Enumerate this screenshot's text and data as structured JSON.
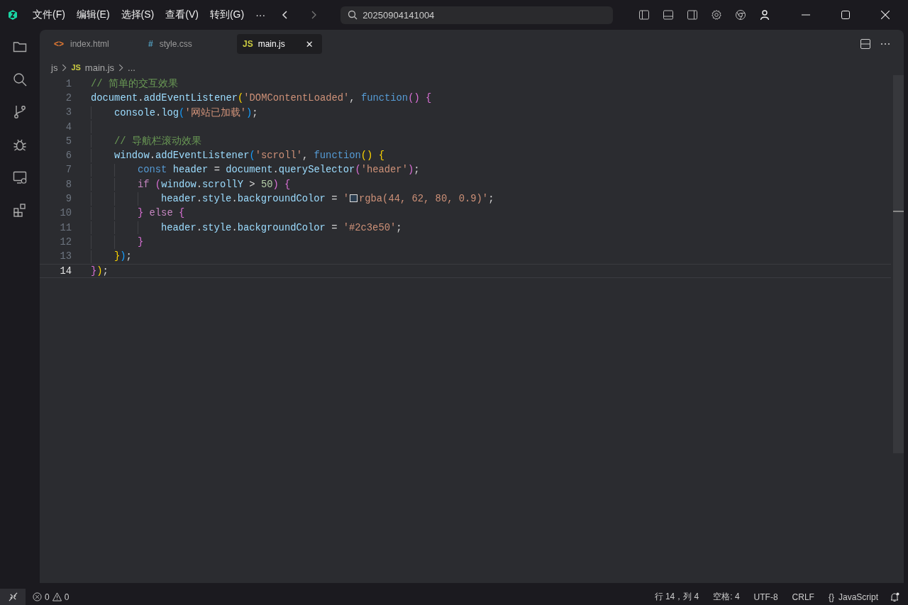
{
  "menu": [
    "文件(F)",
    "编辑(E)",
    "选择(S)",
    "查看(V)",
    "转到(G)",
    "···"
  ],
  "command_center": {
    "value": "20250904141004"
  },
  "activity_bar": [
    {
      "kind": "files",
      "selected": false
    },
    {
      "kind": "search",
      "selected": false
    },
    {
      "kind": "branch",
      "selected": false
    },
    {
      "kind": "bug",
      "selected": false
    },
    {
      "kind": "remote",
      "selected": false
    },
    {
      "kind": "extensions",
      "selected": false
    }
  ],
  "tabs": [
    {
      "label": "index.html",
      "kind": "html",
      "icon": "<>",
      "selected": false
    },
    {
      "label": "style.css",
      "kind": "css",
      "icon": "#",
      "selected": false
    },
    {
      "label": "main.js",
      "kind": "js",
      "icon": "JS",
      "selected": true,
      "close": "✕"
    }
  ],
  "breadcrumb": [
    {
      "text": "js"
    },
    {
      "text": "main.js",
      "icon": "JS"
    },
    {
      "text": "..."
    }
  ],
  "code": [
    {
      "number": "1",
      "current": false,
      "tokens": [
        {
          "kind": "comment",
          "text": "// 简单的交互效果"
        }
      ]
    },
    {
      "number": "2",
      "current": false,
      "tokens": [
        {
          "kind": "var",
          "text": "document"
        },
        {
          "kind": "plain",
          "text": "."
        },
        {
          "kind": "var",
          "text": "addEventListener"
        },
        {
          "kind": "b1",
          "text": "("
        },
        {
          "kind": "string",
          "text": "'DOMContentLoaded'"
        },
        {
          "kind": "plain",
          "text": ", "
        },
        {
          "kind": "keyword",
          "text": "function"
        },
        {
          "kind": "b2",
          "text": "()"
        },
        {
          "kind": "b2",
          "text": " {"
        }
      ],
      "children": [
        {
          "number": "3",
          "current": false,
          "tokens": [
            {
              "kind": "var",
              "text": "console"
            },
            {
              "kind": "plain",
              "text": "."
            },
            {
              "kind": "var",
              "text": "log"
            },
            {
              "kind": "b3",
              "text": "("
            },
            {
              "kind": "string",
              "text": "'网站已加载'"
            },
            {
              "kind": "b3",
              "text": ")"
            },
            {
              "kind": "plain",
              "text": ";"
            }
          ]
        },
        {
          "number": "4",
          "current": false
        },
        {
          "number": "5",
          "current": false,
          "tokens": [
            {
              "kind": "comment",
              "text": "// 导航栏滚动效果"
            }
          ]
        },
        {
          "number": "6",
          "current": false,
          "tokens": [
            {
              "kind": "var",
              "text": "window"
            },
            {
              "kind": "plain",
              "text": "."
            },
            {
              "kind": "var",
              "text": "addEventListener"
            },
            {
              "kind": "b3",
              "text": "("
            },
            {
              "kind": "string",
              "text": "'scroll'"
            },
            {
              "kind": "plain",
              "text": ", "
            },
            {
              "kind": "keyword",
              "text": "function"
            },
            {
              "kind": "b1",
              "text": "()"
            },
            {
              "kind": "b1",
              "text": " {"
            }
          ],
          "children": [
            {
              "number": "7",
              "current": false,
              "tokens": [
                {
                  "kind": "keyword",
                  "text": "const"
                },
                {
                  "kind": "var",
                  "text": " header"
                },
                {
                  "kind": "plain",
                  "text": " = "
                },
                {
                  "kind": "var",
                  "text": "document"
                },
                {
                  "kind": "plain",
                  "text": "."
                },
                {
                  "kind": "var",
                  "text": "querySelector"
                },
                {
                  "kind": "b2",
                  "text": "("
                },
                {
                  "kind": "string",
                  "text": "'header'"
                },
                {
                  "kind": "b2",
                  "text": ")"
                },
                {
                  "kind": "plain",
                  "text": ";"
                }
              ]
            },
            {
              "number": "8",
              "current": false,
              "tokens": [
                {
                  "kind": "control",
                  "text": "if"
                },
                {
                  "kind": "b2",
                  "text": " ("
                },
                {
                  "kind": "var",
                  "text": "window"
                },
                {
                  "kind": "plain",
                  "text": "."
                },
                {
                  "kind": "var",
                  "text": "scrollY"
                },
                {
                  "kind": "plain",
                  "text": " > "
                },
                {
                  "kind": "number",
                  "text": "50"
                },
                {
                  "kind": "b2",
                  "text": ")"
                },
                {
                  "kind": "b2",
                  "text": " {"
                }
              ],
              "children": [
                {
                  "number": "9",
                  "current": false,
                  "tokens": [
                    {
                      "kind": "var",
                      "text": "header"
                    },
                    {
                      "kind": "plain",
                      "text": "."
                    },
                    {
                      "kind": "var",
                      "text": "style"
                    },
                    {
                      "kind": "plain",
                      "text": "."
                    },
                    {
                      "kind": "var",
                      "text": "backgroundColor"
                    },
                    {
                      "kind": "plain",
                      "text": " = "
                    },
                    {
                      "kind": "string",
                      "text": "'"
                    },
                    {
                      "kind": "swatch",
                      "color": "#2c3e50"
                    },
                    {
                      "kind": "string",
                      "text": "rgba(44, 62, 80, 0.9)'"
                    },
                    {
                      "kind": "plain",
                      "text": ";"
                    }
                  ]
                }
              ]
            },
            {
              "number": "10",
              "current": false,
              "tokens": [
                {
                  "kind": "b2",
                  "text": "}"
                },
                {
                  "kind": "control",
                  "text": " else"
                },
                {
                  "kind": "b2",
                  "text": " {"
                }
              ],
              "children": [
                {
                  "number": "11",
                  "current": false,
                  "tokens": [
                    {
                      "kind": "var",
                      "text": "header"
                    },
                    {
                      "kind": "plain",
                      "text": "."
                    },
                    {
                      "kind": "var",
                      "text": "style"
                    },
                    {
                      "kind": "plain",
                      "text": "."
                    },
                    {
                      "kind": "var",
                      "text": "backgroundColor"
                    },
                    {
                      "kind": "plain",
                      "text": " = "
                    },
                    {
                      "kind": "string",
                      "text": "'#2c3e50'"
                    },
                    {
                      "kind": "plain",
                      "text": ";"
                    }
                  ]
                }
              ]
            },
            {
              "number": "12",
              "current": false,
              "tokens": [
                {
                  "kind": "b2",
                  "text": "}"
                }
              ]
            }
          ]
        },
        {
          "number": "13",
          "current": false,
          "tokens": [
            {
              "kind": "b1",
              "text": "}"
            },
            {
              "kind": "b3",
              "text": ")"
            },
            {
              "kind": "plain",
              "text": ";"
            }
          ]
        }
      ]
    },
    {
      "number": "14",
      "current": true,
      "tokens": [
        {
          "kind": "b2",
          "text": "}"
        },
        {
          "kind": "b1",
          "text": ")"
        },
        {
          "kind": "plain",
          "text": ";"
        }
      ]
    }
  ],
  "status_bar": {
    "errors": "0",
    "warnings": "0",
    "position": "行 14，列 4",
    "spaces": "空格: 4",
    "encoding": "UTF-8",
    "eol": "CRLF",
    "language_icon": "{}",
    "language": "JavaScript"
  }
}
